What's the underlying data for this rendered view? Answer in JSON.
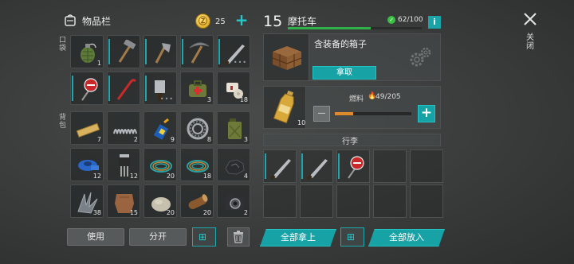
{
  "inventory": {
    "title": "物品栏",
    "coin_count": "25",
    "section_equip": "口袋",
    "section_backpack": "背包",
    "rows": [
      [
        {
          "name": "grenade",
          "qty": "1"
        },
        {
          "name": "sledgehammer",
          "qty": ""
        },
        {
          "name": "hatchet",
          "qty": ""
        },
        {
          "name": "pickaxe",
          "qty": ""
        },
        {
          "name": "machete",
          "qty": ""
        }
      ],
      [
        {
          "name": "stop-sign",
          "qty": ""
        },
        {
          "name": "crowbar",
          "qty": ""
        },
        {
          "name": "cleaver",
          "qty": ""
        },
        {
          "name": "medkit",
          "qty": "3"
        },
        {
          "name": "bandage",
          "qty": "18"
        }
      ],
      [
        {
          "name": "wooden-plank",
          "qty": "7"
        },
        {
          "name": "spring",
          "qty": "2"
        },
        {
          "name": "glue",
          "qty": "9"
        },
        {
          "name": "bearing",
          "qty": "8"
        },
        {
          "name": "jerry-can",
          "qty": "3"
        }
      ],
      [
        {
          "name": "duct-tape",
          "qty": "12"
        },
        {
          "name": "transistor",
          "qty": "12"
        },
        {
          "name": "wire",
          "qty": "20"
        },
        {
          "name": "wire",
          "qty": "18"
        },
        {
          "name": "coal",
          "qty": "4"
        }
      ],
      [
        {
          "name": "scrap-metal",
          "qty": "38"
        },
        {
          "name": "leather",
          "qty": "15"
        },
        {
          "name": "stone",
          "qty": "20"
        },
        {
          "name": "log",
          "qty": "20"
        },
        {
          "name": "camera",
          "qty": "2"
        }
      ]
    ],
    "use_label": "使用",
    "split_label": "分开",
    "colors": {
      "accent": "#17a3a6",
      "durability": "#1fa7ad"
    }
  },
  "vehicle": {
    "level": "15",
    "name": "摩托车",
    "health": "62/100",
    "equip_box_label": "含装备的箱子",
    "take_button": "拿取",
    "fuel_label": "燃料",
    "fuel_value": "49/205",
    "fuel_fraction": 0.24,
    "bottle_qty": "10",
    "minus": "—",
    "plus": "+",
    "trunk_label": "行李",
    "trunk_items": [
      "machete",
      "machete",
      "stop-sign",
      "",
      "",
      "",
      "",
      "",
      "",
      "",
      "",
      "",
      "",
      "",
      "",
      ""
    ],
    "take_all": "全部拿上",
    "put_all": "全部放入"
  },
  "close_label": "关闭",
  "info": "i"
}
